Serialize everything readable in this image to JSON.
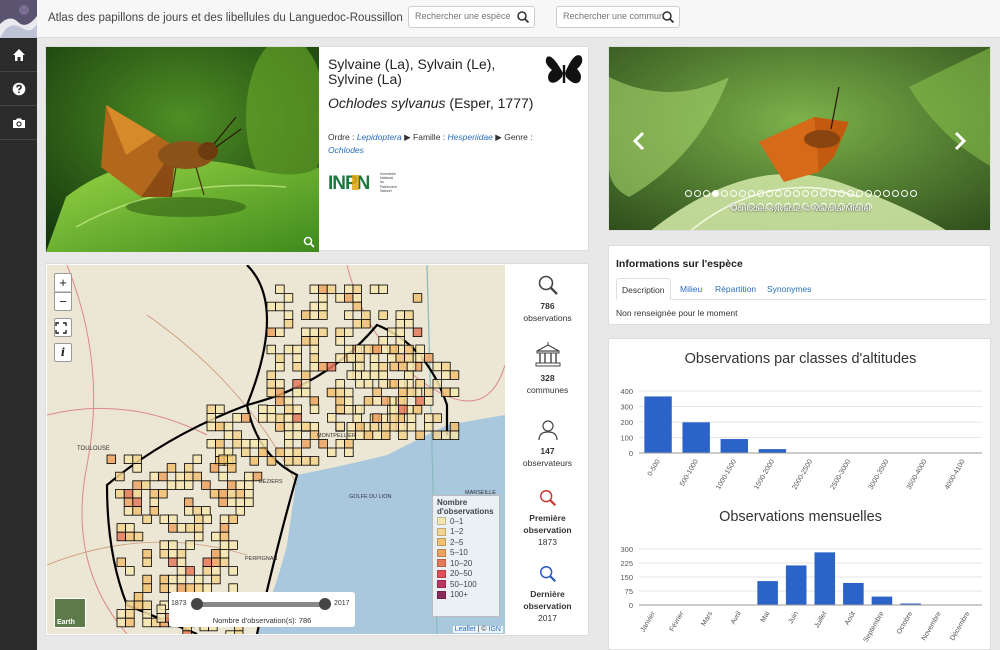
{
  "header": {
    "title": "Atlas des papillons de jours et des libellules du Languedoc-Roussillon",
    "search_species_placeholder": "Rechercher une espèce",
    "search_commune_placeholder": "Rechercher une commune"
  },
  "sidebar": {
    "items": [
      {
        "icon": "home-icon"
      },
      {
        "icon": "question-icon"
      },
      {
        "icon": "camera-icon"
      }
    ]
  },
  "species": {
    "common_name": "Sylvaine (La), Sylvain (Le), Sylvine (La)",
    "scientific_name": "Ochlodes sylvanus",
    "author": "(Esper, 1777)",
    "order_label": "Ordre :",
    "order": "Lepidoptera",
    "family_label": "Famille :",
    "family": "Hesperiidae",
    "genus_label": "Genre :",
    "genus": "Ochlodes",
    "inpn_logo": "INPN",
    "inpn_sub": "Inventaire National du Patrimoine Naturel"
  },
  "carousel": {
    "credit": "Ochlodes sylvanus © Marchal Michel",
    "active_index": 3,
    "dot_count": 42
  },
  "info": {
    "title": "Informations sur l'espèce",
    "tabs": [
      "Description",
      "Milieu",
      "Répartition",
      "Synonymes"
    ],
    "active_tab": 0,
    "text": "Non renseignée pour le moment"
  },
  "map": {
    "zoom_in": "+",
    "zoom_out": "−",
    "info_button": "i",
    "legend_title": "Nombre d'observations",
    "legend": [
      {
        "label": "0–1",
        "color": "#f7e5b0"
      },
      {
        "label": "1–2",
        "color": "#f4d48e"
      },
      {
        "label": "2–5",
        "color": "#f1bf72"
      },
      {
        "label": "5–10",
        "color": "#eda362"
      },
      {
        "label": "10–20",
        "color": "#e6785a"
      },
      {
        "label": "20–50",
        "color": "#dc5158"
      },
      {
        "label": "50–100",
        "color": "#bc3760"
      },
      {
        "label": "100+",
        "color": "#8c2a5e"
      }
    ],
    "layer_label": "Earth",
    "slider_min": "1873",
    "slider_max": "2017",
    "slider_caption": "Nombre d'observation(s): 786",
    "attribution_leaflet": "Leaflet",
    "attribution_sep": "| ©",
    "attribution_ign": "IGN",
    "place_labels": [
      "TOULOUSE",
      "BÉZIERS",
      "GOLFE DU LION",
      "PERPIGNAN",
      "MONTPELLIER",
      "MARSEILLE"
    ]
  },
  "stats": [
    {
      "icon": "search-icon",
      "value": "786",
      "label": "observations"
    },
    {
      "icon": "town-hall-icon",
      "value": "328",
      "label": "communes"
    },
    {
      "icon": "user-icon",
      "value": "147",
      "label": "observateurs"
    },
    {
      "icon": "search-red-icon",
      "value": "Première observation",
      "label": "1873"
    },
    {
      "icon": "search-blue-icon",
      "value": "Dernière observation",
      "label": "2017"
    }
  ],
  "chart_data": [
    {
      "type": "bar",
      "title": "Observations par classes d'altitudes",
      "categories": [
        "0-500",
        "500-1000",
        "1000-1500",
        "1500-2000",
        "2000-2500",
        "2500-3000",
        "3000-3500",
        "3500-4000",
        "4000-4100"
      ],
      "values": [
        365,
        198,
        90,
        25,
        0,
        0,
        0,
        0,
        0
      ],
      "ylim": [
        0,
        400
      ],
      "yticks": [
        "0",
        "100",
        "200",
        "300",
        "400"
      ],
      "color": "#2b63c9"
    },
    {
      "type": "bar",
      "title": "Observations mensuelles",
      "categories": [
        "Janvier",
        "Février",
        "Mars",
        "Avril",
        "Mai",
        "Juin",
        "Juillet",
        "Août",
        "Septembre",
        "Octobre",
        "Novembre",
        "Décembre"
      ],
      "values": [
        0,
        0,
        0,
        2,
        128,
        212,
        282,
        118,
        45,
        8,
        0,
        0
      ],
      "ylim": [
        0,
        300
      ],
      "yticks": [
        "0",
        "75",
        "150",
        "225",
        "300"
      ],
      "color": "#2b63c9"
    }
  ]
}
